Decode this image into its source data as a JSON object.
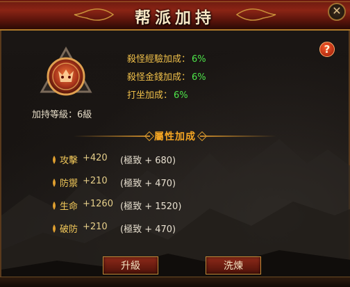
{
  "window": {
    "title": "帮派加持"
  },
  "guild": {
    "level_label": "加持等級：6級"
  },
  "bonuses": [
    {
      "label": "殺怪經驗加成：",
      "value": "6%"
    },
    {
      "label": "殺怪金錢加成：",
      "value": "6%"
    },
    {
      "label": "打坐加成：",
      "value": "6%"
    }
  ],
  "section": {
    "title": "屬性加成"
  },
  "attributes": [
    {
      "name": "攻擊",
      "bonus": "+420",
      "max": "(極致 + 680)"
    },
    {
      "name": "防禦",
      "bonus": "+210",
      "max": "(極致 + 470)"
    },
    {
      "name": "生命",
      "bonus": "+1260",
      "max": "(極致 + 1520)"
    },
    {
      "name": "破防",
      "bonus": "+210",
      "max": "(極致 + 470)"
    }
  ],
  "buttons": {
    "upgrade": "升級",
    "refine": "洗煉"
  },
  "help": {
    "label": "?"
  },
  "icons": {
    "close": "close-icon",
    "help": "help-icon",
    "emblem": "guild-emblem-icon"
  },
  "colors": {
    "accent": "#f5a623",
    "value_green": "#4ee64a",
    "title_red": "#8a2415"
  }
}
